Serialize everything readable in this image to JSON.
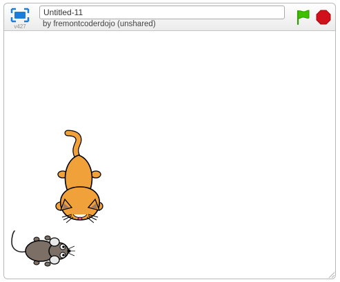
{
  "header": {
    "version": "v427",
    "project_title": "Untitled-11",
    "byline": "by fremontcoderdojo (unshared)"
  },
  "icons": {
    "fullscreen": "fullscreen-icon",
    "green_flag": "green-flag-icon",
    "stop": "stop-sign-icon"
  },
  "colors": {
    "accent_blue": "#1c7cd6",
    "flag_green": "#3fbf00",
    "stop_red": "#d0101a",
    "cat_orange": "#f0a13a",
    "mouse_brown": "#7b6f66"
  },
  "stage": {
    "sprites": [
      "cat",
      "mouse"
    ]
  }
}
